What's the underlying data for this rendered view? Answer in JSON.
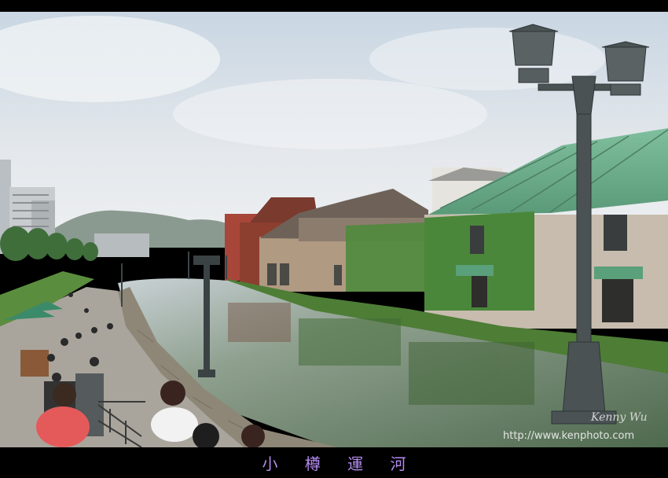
{
  "caption": "小 樽 運 河",
  "watermark": {
    "signature": "Kenny Wu",
    "url": "http://www.kenphoto.com"
  },
  "colors": {
    "frame": "#000000",
    "caption": "#b48cf0",
    "sky": "#dfe6ec",
    "canal": "#6f8a73",
    "roof": "#6fae8c",
    "ivy": "#4f8a3c"
  }
}
